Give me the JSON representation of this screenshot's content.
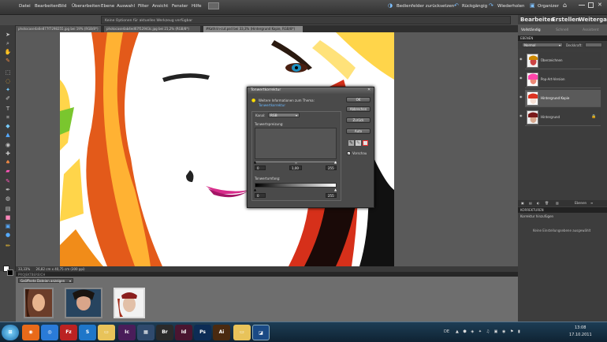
{
  "menubar": {
    "items": [
      "Datei",
      "Bearbeiten",
      "Bild",
      "Überarbeiten",
      "Ebene",
      "Auswahl",
      "Filter",
      "Ansicht",
      "Fenster",
      "Hilfe"
    ],
    "reset_panels": "Bedienfelder zurücksetzen",
    "undo": "Rückgängig",
    "redo": "Wiederholen",
    "organizer": "Organizer"
  },
  "tip": "Keine Optionen für aktuelles Werkzeug verfügbar",
  "doc_tabs": [
    "photocase4a6e877f7298255.jpg bei 19% (RGB/8*)",
    "photocase4ab4ed67f12943c.jpg bei 21,2% (RGB/8*)",
    "#Kathrin-cut.psd bei 33,3% (Hintergrund Kopie, RGB/8*)"
  ],
  "status": {
    "zoom": "33,33%",
    "info": "26,82 cm x 40,75 cm (300 ppi)"
  },
  "project_bin": {
    "header": "PROJEKTBEREICH",
    "dropdown": "Geöffnete Dateien anzeigen"
  },
  "right_panel": {
    "tabs": [
      "Bearbeiten",
      "Erstellen",
      "Weitergabe"
    ],
    "subtabs": [
      "Vollständig",
      "Schnell",
      "Assistent"
    ],
    "layers_header": "EBENEN",
    "blend_mode": "Normal",
    "opacity_label": "Deckkraft:",
    "layers": [
      {
        "name": "Überzeichnen"
      },
      {
        "name": "Pop-Art-Version"
      },
      {
        "name": "Hintergrund Kopie"
      },
      {
        "name": "Hintergrund"
      }
    ],
    "comments_header": "KORREKTUREN",
    "comments_sub": "Korrektur hinzufügen",
    "comments_empty": "Keine Einstellungsebene ausgewählt",
    "layers_bottom_label": "Ebenen"
  },
  "dialog": {
    "title": "Tonwertkorrektur",
    "info_text": "Weitere Informationen zum Thema:",
    "info_link": "Tonwertkorrektur",
    "channel_label": "Kanal:",
    "channel_value": "RGB",
    "input_label": "Tonwertspreizung:",
    "input_values": [
      "0",
      "1,00",
      "255"
    ],
    "output_label": "Tonwertumfang:",
    "output_values": [
      "0",
      "255"
    ],
    "buttons": [
      "OK",
      "Abbrechen",
      "Zurück",
      "Auto"
    ],
    "preview_label": "Vorschau"
  },
  "taskbar": {
    "language": "DE",
    "time": "13:08",
    "date": "17.10.2011"
  }
}
